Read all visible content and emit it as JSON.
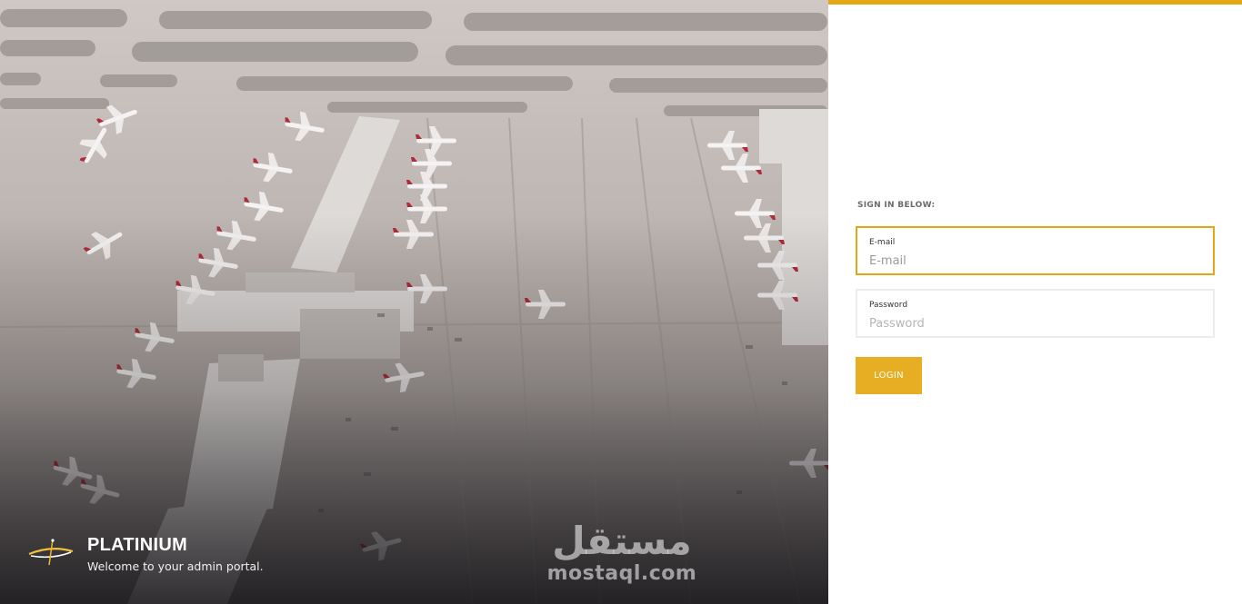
{
  "brand": {
    "name": "PLATINIUM",
    "tagline": "Welcome to your admin portal.",
    "logo_icon": "plane-swoosh-icon"
  },
  "watermark": {
    "arabic": "مستقل",
    "latin": "mostaql.com"
  },
  "signin": {
    "heading": "SIGN IN BELOW:",
    "email": {
      "label": "E-mail",
      "placeholder": "E-mail",
      "value": ""
    },
    "password": {
      "label": "Password",
      "placeholder": "Password",
      "value": ""
    },
    "login_label": "LOGIN"
  },
  "colors": {
    "accent": "#e3a614",
    "button": "#e7ad23",
    "panel_bg": "#ffffff"
  }
}
